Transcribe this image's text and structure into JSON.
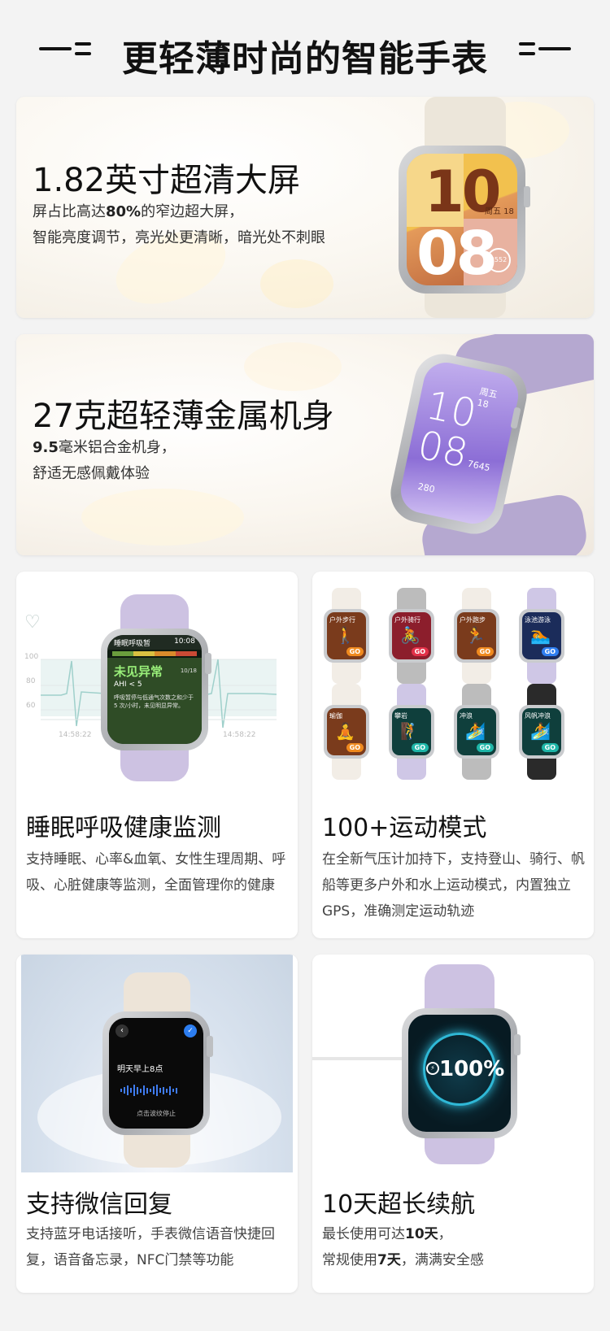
{
  "header": {
    "title": "更轻薄时尚的智能手表"
  },
  "hero1": {
    "title": "1.82英寸超清大屏",
    "desc_line1_pre": "屏占比高达",
    "desc_line1_bold": "80%",
    "desc_line1_post": "的窄边超大屏，",
    "desc_line2": "智能亮度调节，亮光处更清晰，暗光处不刺眼",
    "watch": {
      "hour": "10",
      "minute": "08",
      "date": "周五 18",
      "steps": "2552"
    }
  },
  "hero2": {
    "title": "27克超轻薄金属机身",
    "desc_line1_bold": "9.5",
    "desc_line1_post": "毫米铝合金机身，",
    "desc_line2": "舒适无感佩戴体验",
    "watch": {
      "hour": "10",
      "minute": "08",
      "date": "周五\n18",
      "steps": "7645",
      "cal": "280"
    }
  },
  "sleep": {
    "title": "睡眠呼吸健康监测",
    "desc": "支持睡眠、心率&血氧、女性生理周期、呼吸、心脏健康等监测，全面管理你的健康",
    "screen": {
      "app": "睡眠呼吸暂",
      "time": "10:08",
      "status": "未见异常",
      "date": "10/18",
      "ahi": "AHI < 5",
      "note": "呼吸暂停与低通气次数之和少于 5 次/小时，未见明显异常。"
    },
    "chart": {
      "y_ticks": [
        "100",
        "80",
        "60"
      ],
      "t_left": "14:58:22",
      "t_right": "14:58:22"
    }
  },
  "sports": {
    "title": "100+运动模式",
    "desc": "在全新气压计加持下，支持登山、骑行、帆船等更多户外和水上运动模式，内置独立GPS，准确测定运动轨迹",
    "modes": [
      {
        "label": "户外步行",
        "go": "GO"
      },
      {
        "label": "户外骑行",
        "go": "GO"
      },
      {
        "label": "户外跑步",
        "go": "GO"
      },
      {
        "label": "泳池游泳",
        "go": "GO"
      },
      {
        "label": "瑜伽",
        "go": "GO"
      },
      {
        "label": "攀岩",
        "go": "GO"
      },
      {
        "label": "冲浪",
        "go": "GO"
      },
      {
        "label": "风帆冲浪",
        "go": "GO"
      }
    ],
    "colors": [
      "#7a3b1c",
      "#8c1e2c",
      "#7a3b1c",
      "#1b2c5a",
      "#7a3b1c",
      "#0f3f3c",
      "#0f3f3c",
      "#0f3f3c"
    ],
    "bands": [
      "#f2ede6",
      "#bcbcbc",
      "#f2ede6",
      "#cfc7e6",
      "#f2ede6",
      "#cfc7e6",
      "#bcbcbc",
      "#2a2a2a"
    ],
    "go_colors": [
      "#f08a1e",
      "#e23148",
      "#f08a1e",
      "#2f7ef0",
      "#f08a1e",
      "#1eb6a8",
      "#1eb6a8",
      "#1eb6a8"
    ],
    "figs": [
      "🚶",
      "🚴",
      "🏃",
      "🏊",
      "🧘",
      "🧗",
      "🏄",
      "🏄"
    ]
  },
  "wechat": {
    "title": "支持微信回复",
    "desc": "支持蓝牙电话接听，手表微信语音快捷回复，语音备忘录，NFC门禁等功能",
    "screen": {
      "text": "明天早上8点",
      "hint": "点击波纹停止"
    }
  },
  "battery": {
    "title": "10天超长续航",
    "desc_line1_pre": "最长使用可达",
    "desc_line1_bold": "10天",
    "desc_line1_post": "，",
    "desc_line2_pre": "常规使用",
    "desc_line2_bold": "7天",
    "desc_line2_post": "，满满安全感",
    "screen": {
      "value": "100%"
    }
  }
}
